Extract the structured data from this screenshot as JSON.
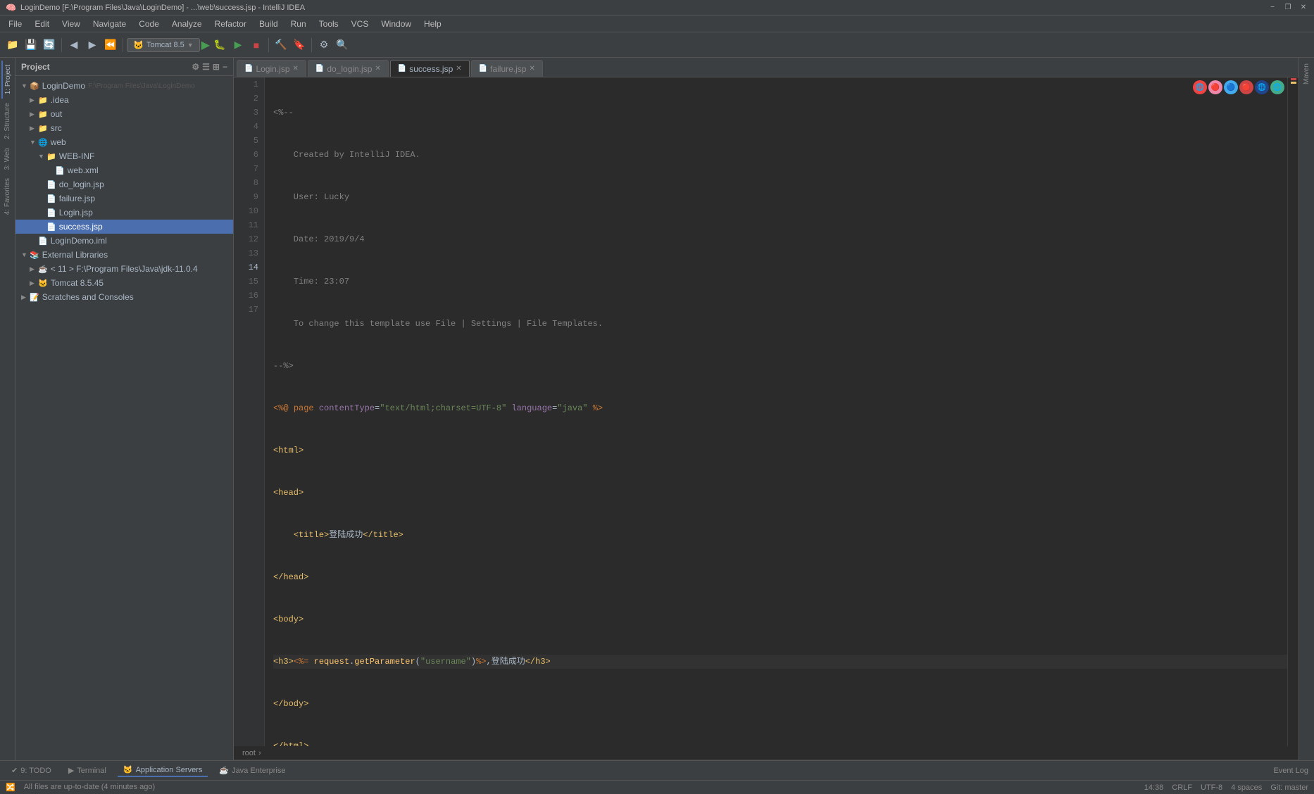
{
  "window": {
    "title": "LoginDemo [F:\\Program Files\\Java\\LoginDemo] - ...\\web\\success.jsp - IntelliJ IDEA",
    "min_btn": "−",
    "max_btn": "❐",
    "close_btn": "✕"
  },
  "menu": {
    "items": [
      "File",
      "Edit",
      "View",
      "Navigate",
      "Code",
      "Analyze",
      "Refactor",
      "Build",
      "Run",
      "Tools",
      "VCS",
      "Window",
      "Help"
    ]
  },
  "toolbar": {
    "run_config": "Tomcat 8.5",
    "run_config_arrow": "▼"
  },
  "project_panel": {
    "title": "Project",
    "root": "LoginDemo",
    "root_path": "F:\\Program Files\\Java\\LoginDemo",
    "items": [
      {
        "id": "idea",
        "label": ".idea",
        "indent": 2,
        "type": "folder",
        "expanded": false
      },
      {
        "id": "out",
        "label": "out",
        "indent": 2,
        "type": "folder",
        "expanded": true
      },
      {
        "id": "src",
        "label": "src",
        "indent": 2,
        "type": "folder",
        "expanded": false
      },
      {
        "id": "web",
        "label": "web",
        "indent": 2,
        "type": "folder",
        "expanded": true
      },
      {
        "id": "WEB-INF",
        "label": "WEB-INF",
        "indent": 4,
        "type": "folder",
        "expanded": true
      },
      {
        "id": "web.xml",
        "label": "web.xml",
        "indent": 6,
        "type": "xml"
      },
      {
        "id": "do_login.jsp",
        "label": "do_login.jsp",
        "indent": 4,
        "type": "jsp"
      },
      {
        "id": "failure.jsp",
        "label": "failure.jsp",
        "indent": 4,
        "type": "jsp"
      },
      {
        "id": "Login.jsp",
        "label": "Login.jsp",
        "indent": 4,
        "type": "jsp"
      },
      {
        "id": "success.jsp",
        "label": "success.jsp",
        "indent": 4,
        "type": "jsp",
        "selected": true
      },
      {
        "id": "LoginDemo.iml",
        "label": "LoginDemo.iml",
        "indent": 2,
        "type": "iml"
      },
      {
        "id": "External Libraries",
        "label": "External Libraries",
        "indent": 1,
        "type": "lib",
        "expanded": true
      },
      {
        "id": "jdk-11",
        "label": "< 11 > F:\\Program Files\\Java\\jdk-11.0.4",
        "indent": 3,
        "type": "sdk"
      },
      {
        "id": "tomcat",
        "label": "Tomcat 8.5.45",
        "indent": 3,
        "type": "tomcat"
      },
      {
        "id": "Scratches and Consoles",
        "label": "Scratches and Consoles",
        "indent": 1,
        "type": "scratch"
      }
    ]
  },
  "tabs": [
    {
      "id": "login",
      "label": "Login.jsp",
      "active": false,
      "closable": true
    },
    {
      "id": "do_login",
      "label": "do_login.jsp",
      "active": false,
      "closable": true
    },
    {
      "id": "success",
      "label": "success.jsp",
      "active": true,
      "closable": true
    },
    {
      "id": "failure",
      "label": "failure.jsp",
      "active": false,
      "closable": true
    }
  ],
  "breadcrumb": {
    "items": [
      "root",
      ">"
    ]
  },
  "code": {
    "lines": [
      {
        "num": 1,
        "content": "<%--",
        "style": "comment"
      },
      {
        "num": 2,
        "content": "    Created by IntelliJ IDEA.",
        "style": "comment"
      },
      {
        "num": 3,
        "content": "    User: Lucky",
        "style": "comment"
      },
      {
        "num": 4,
        "content": "    Date: 2019/9/4",
        "style": "comment"
      },
      {
        "num": 5,
        "content": "    Time: 23:07",
        "style": "comment"
      },
      {
        "num": 6,
        "content": "    To change this template use File | Settings | File Templates.",
        "style": "comment"
      },
      {
        "num": 7,
        "content": "--%>",
        "style": "comment"
      },
      {
        "num": 8,
        "content": "<%@ page contentType=\"text/html;charset=UTF-8\" language=\"java\" %>",
        "style": "jsp"
      },
      {
        "num": 9,
        "content": "<html>",
        "style": "html"
      },
      {
        "num": 10,
        "content": "<head>",
        "style": "html"
      },
      {
        "num": 11,
        "content": "    <title>登陆成功</title>",
        "style": "html"
      },
      {
        "num": 12,
        "content": "</head>",
        "style": "html"
      },
      {
        "num": 13,
        "content": "<body>",
        "style": "html"
      },
      {
        "num": 14,
        "content": "<h3><%= request.getParameter(\"username\")%>,登陆成功</h3>",
        "style": "active html"
      },
      {
        "num": 15,
        "content": "</body>",
        "style": "html"
      },
      {
        "num": 16,
        "content": "</html>",
        "style": "html"
      },
      {
        "num": 17,
        "content": "",
        "style": ""
      }
    ]
  },
  "right_sidebar": {
    "label": ""
  },
  "bottom_tabs": [
    {
      "id": "todo",
      "label": "TODO",
      "num": "9"
    },
    {
      "id": "terminal",
      "label": "Terminal"
    },
    {
      "id": "app_servers",
      "label": "Application Servers"
    },
    {
      "id": "java_enterprise",
      "label": "Java Enterprise"
    }
  ],
  "status_bar": {
    "left": "All files are up-to-date (4 minutes ago)",
    "right_items": [
      "14:38",
      "CRLF",
      "UTF-8",
      "4 spaces",
      "Git: master"
    ]
  },
  "event_log": "Event Log"
}
